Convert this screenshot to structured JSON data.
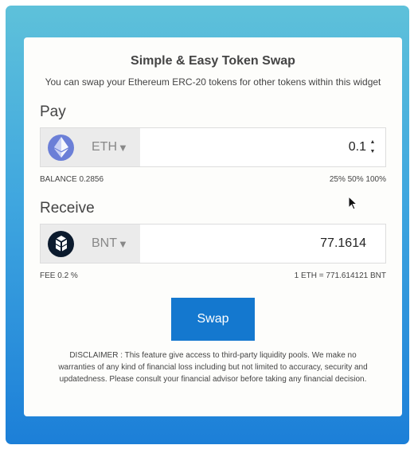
{
  "widget": {
    "title": "Simple & Easy Token Swap",
    "subtitle": "You can swap your Ethereum ERC-20 tokens for other tokens within this widget"
  },
  "pay": {
    "label": "Pay",
    "token": "ETH",
    "token_icon": "ethereum-icon",
    "amount": "0.1",
    "balance": "BALANCE 0.2856",
    "percent_options": [
      "25%",
      "50%",
      "100%"
    ]
  },
  "receive": {
    "label": "Receive",
    "token": "BNT",
    "token_icon": "bancor-icon",
    "amount": "77.1614",
    "fee": "FEE 0.2 %",
    "rate": "1 ETH = 771.614121 BNT"
  },
  "swap_button": "Swap",
  "disclaimer": "DISCLAIMER : This feature give access to third-party liquidity pools. We make no warranties of any kind of financial loss including but not limited to accuracy, security and updatedness. Please consult your financial advisor before taking any financial decision.",
  "colors": {
    "accent": "#1478cf",
    "eth_icon": "#6b7fd7",
    "bnt_icon": "#0b1a2d"
  }
}
